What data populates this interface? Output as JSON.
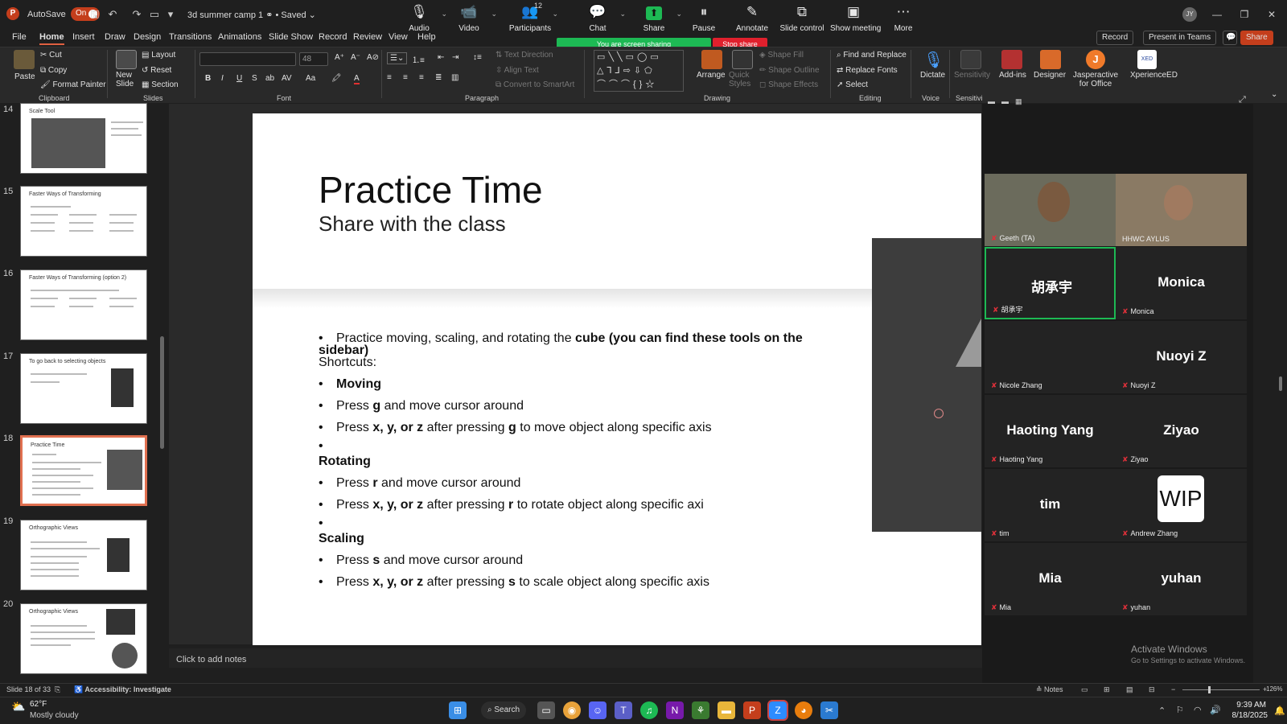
{
  "titlebar": {
    "autosave_label": "AutoSave",
    "autosave_state": "On",
    "doc_title": "3d summer camp 1 ⚭ • Saved ⌄",
    "user_initials": "JY"
  },
  "meeting_toolbar": {
    "audio": "Audio",
    "video": "Video",
    "participants": "Participants",
    "participants_count": "12",
    "chat": "Chat",
    "share": "Share",
    "pause": "Pause",
    "annotate": "Annotate",
    "slide_control": "Slide control",
    "show_meeting": "Show meeting",
    "more": "More",
    "sharing_banner": "You are screen sharing",
    "stop_share": "Stop share"
  },
  "tabs": [
    "File",
    "Home",
    "Insert",
    "Draw",
    "Design",
    "Transitions",
    "Animations",
    "Slide Show",
    "Record",
    "Review",
    "View",
    "Help"
  ],
  "top_right": {
    "record": "Record",
    "present_teams": "Present in Teams",
    "share": "Share"
  },
  "ribbon": {
    "clipboard": {
      "paste": "Paste",
      "cut": "Cut",
      "copy": "Copy",
      "format_painter": "Format Painter",
      "label": "Clipboard"
    },
    "slides": {
      "new_slide": "New Slide",
      "layout": "Layout",
      "reset": "Reset",
      "section": "Section",
      "label": "Slides"
    },
    "font": {
      "size": "48",
      "label": "Font"
    },
    "paragraph": {
      "text_direction": "Text Direction",
      "align_text": "Align Text",
      "convert_smartart": "Convert to SmartArt",
      "label": "Paragraph"
    },
    "drawing": {
      "arrange": "Arrange",
      "quick_styles": "Quick Styles",
      "shape_fill": "Shape Fill",
      "shape_outline": "Shape Outline",
      "shape_effects": "Shape Effects",
      "label": "Drawing"
    },
    "editing": {
      "find_replace": "Find and Replace",
      "replace_fonts": "Replace Fonts",
      "select": "Select",
      "label": "Editing"
    },
    "voice": {
      "dictate": "Dictate",
      "label": "Voice"
    },
    "sensitivity": {
      "btn": "Sensitivity",
      "label": "Sensitivi"
    },
    "addins": "Add-ins",
    "designer": "Designer",
    "jasperactive": "Jasperactive for Office",
    "xperienced": "XperienceED"
  },
  "slide_thumbs": [
    {
      "num": "14",
      "title": "Scale Tool"
    },
    {
      "num": "15",
      "title": "Faster Ways of Transforming"
    },
    {
      "num": "16",
      "title": "Faster Ways of Transforming (option 2)"
    },
    {
      "num": "17",
      "title": "To go back to selecting objects"
    },
    {
      "num": "18",
      "title": "Practice Time"
    },
    {
      "num": "19",
      "title": "Orthographic Views"
    },
    {
      "num": "20",
      "title": "Orthographic Views"
    }
  ],
  "slide": {
    "title": "Practice Time",
    "subtitle": "Share with the class",
    "intro_normal": "Practice moving, scaling, and rotating the ",
    "intro_bold": "cube (you can find these tools on the",
    "intro_bold2": "sidebar)",
    "shortcuts": "Shortcuts:",
    "moving": "Moving",
    "move_1_a": "Press ",
    "move_1_b": "g",
    "move_1_c": " and move cursor around",
    "move_2_a": "Press ",
    "move_2_b": "x, y, or z",
    "move_2_c": " after pressing ",
    "move_2_d": "g",
    "move_2_e": " to move object along specific axis",
    "rotating": "Rotating",
    "rot_1_a": "Press ",
    "rot_1_b": "r",
    "rot_1_c": " and move cursor around",
    "rot_2_a": "Press ",
    "rot_2_b": "x, y, or z",
    "rot_2_c": " after pressing ",
    "rot_2_d": "r",
    "rot_2_e": " to rotate object along specific axi",
    "scaling": "Scaling",
    "scl_1_a": "Press ",
    "scl_1_b": "s",
    "scl_1_c": " and move cursor around",
    "scl_2_a": "Press ",
    "scl_2_b": "x, y, or z",
    "scl_2_c": " after pressing ",
    "scl_2_d": "s",
    "scl_2_e": " to scale object along specific axis"
  },
  "notes_placeholder": "Click to add notes",
  "participants": [
    {
      "big": "",
      "small": "Geeth (TA)"
    },
    {
      "big": "",
      "small": "HHWC AYLUS"
    },
    {
      "big": "胡承宇",
      "small": "胡承宇"
    },
    {
      "big": "Monica",
      "small": "Monica"
    },
    {
      "big": "",
      "small": "Nicole Zhang"
    },
    {
      "big": "Nuoyi Z",
      "small": "Nuoyi Z"
    },
    {
      "big": "Haoting Yang",
      "small": "Haoting Yang"
    },
    {
      "big": "Ziyao",
      "small": "Ziyao"
    },
    {
      "big": "tim",
      "small": "tim"
    },
    {
      "big": "",
      "small": "Andrew Zhang",
      "avatar": "WIP"
    },
    {
      "big": "Mia",
      "small": "Mia"
    },
    {
      "big": "yuhan",
      "small": "yuhan"
    }
  ],
  "watermark": {
    "line1": "Activate Windows",
    "line2": "Go to Settings to activate Windows."
  },
  "status": {
    "slide_of": "Slide 18 of 33",
    "accessibility": "Accessibility: Investigate",
    "notes": "Notes",
    "zoom": "126%"
  },
  "taskbar": {
    "temp": "62°F",
    "weather": "Mostly cloudy",
    "search": "Search",
    "time": "9:39 AM",
    "date": "8/18/2025"
  }
}
